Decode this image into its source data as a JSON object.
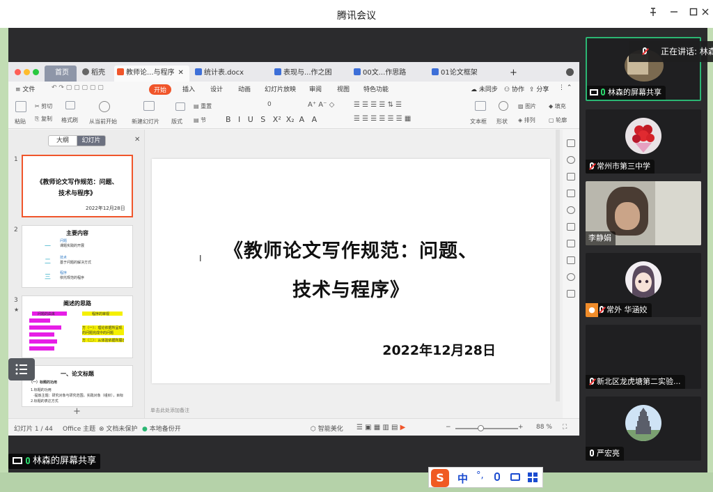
{
  "meeting": {
    "title": "腾讯会议",
    "speaking_label": "正在讲话: 林森",
    "share_label": "林森的屏幕共享"
  },
  "window_controls": [
    "pin-icon",
    "minimize-icon",
    "maximize-icon",
    "close-icon"
  ],
  "wps": {
    "tabs": [
      {
        "label": "首页",
        "kind": "home"
      },
      {
        "label": "稻壳",
        "kind": "docer"
      },
      {
        "label": "教师论...与程序",
        "kind": "ppt",
        "active": true
      },
      {
        "label": "统计表.docx",
        "kind": "doc"
      },
      {
        "label": "表现与...作之困",
        "kind": "doc"
      },
      {
        "label": "00文...作思路",
        "kind": "doc"
      },
      {
        "label": "01论文框架",
        "kind": "doc"
      }
    ],
    "menu": {
      "file": "文件",
      "tabs": [
        "开始",
        "插入",
        "设计",
        "动画",
        "幻灯片放映",
        "审阅",
        "视图",
        "特色功能"
      ],
      "right": [
        "未同步",
        "协作",
        "分享"
      ]
    },
    "ribbon": {
      "paste": "粘贴",
      "cut": "剪切",
      "copy": "复制",
      "format_painter": "格式刷",
      "from_current": "从当前开始",
      "new_slide": "新建幻灯片",
      "layout": "版式",
      "section": "节",
      "reset": "重置",
      "font_size": "0",
      "textbox": "文本框",
      "shape": "形状",
      "picture": "图片",
      "arrange": "排列",
      "fill": "填充",
      "outline": "轮廓"
    },
    "pane": {
      "outline": "大纲",
      "slides": "幻灯片"
    },
    "thumbs": [
      {
        "num": "1",
        "title_a": "《教师论文写作规范：问题、",
        "title_b": "技术与程序》",
        "date": "2022年12月28日"
      },
      {
        "num": "2",
        "title": "主要内容",
        "items": [
          {
            "mark": "一",
            "a": "问题",
            "b": "课题实践的开展"
          },
          {
            "mark": "二",
            "a": "技术",
            "b": "基于问题的解决方式"
          },
          {
            "mark": "三",
            "a": "程序",
            "b": "依托规范的程序"
          }
        ]
      },
      {
        "num": "3",
        "title": "阐述的思路",
        "col_a": "问题的由来",
        "col_b": "程序的审视",
        "yellow_a": "方（一）：理论依据所呈现的问题完成中的问题",
        "yellow_b": "方（二）：从体验依据所展示的"
      },
      {
        "num": "4",
        "title": "一、论文标题",
        "sub": "（一）标题的功用",
        "l1": "1.标题的功用",
        "l2": "·提炼主题：研究对象与研究范围，实践对象（组织），目标",
        "l3": "2.标题的表达方式"
      }
    ],
    "add_slide": "+",
    "slide": {
      "line1": "《教师论文写作规范：问题、",
      "line2": "技术与程序》",
      "date": "2022年12月28日"
    },
    "notes_placeholder": "单击此处添加备注",
    "status": {
      "slide_counter": "幻灯片 1 / 44",
      "theme": "Office 主题",
      "protect": "文档未保护",
      "backup": "本地备份开",
      "beautify": "智能美化",
      "zoom": "88 %"
    }
  },
  "participants": [
    {
      "name": "林森的屏幕共享",
      "mic": "on",
      "kind": "screen",
      "active": true
    },
    {
      "name": "常州市第三中学",
      "mic": "muted",
      "kind": "flowers"
    },
    {
      "name": "李静娟",
      "mic": "none",
      "kind": "camera"
    },
    {
      "name": "常外 华涵姣",
      "mic": "muted",
      "kind": "cartoon",
      "badge": "user-icon"
    },
    {
      "name": "新北区龙虎塘第二实验...",
      "mic": "muted",
      "kind": "blank"
    },
    {
      "name": "严宏亮",
      "mic": "on-white",
      "kind": "pagoda"
    }
  ],
  "ime": {
    "lang": "中",
    "punct": "°,"
  },
  "colors": {
    "accent": "#f0552a",
    "active_border": "#2bb673",
    "stage": "#2b2b2d"
  }
}
